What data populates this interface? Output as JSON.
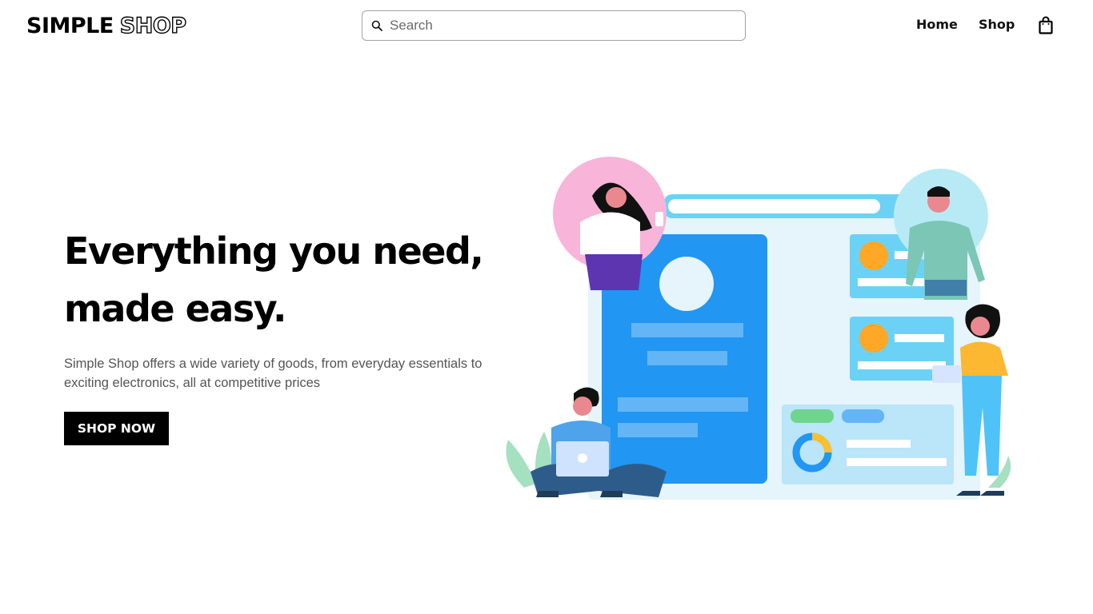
{
  "header": {
    "logo_solid": "SIMPLE",
    "logo_outline": "SHOP",
    "search_placeholder": "Search",
    "search_value": "",
    "nav": {
      "home_label": "Home",
      "shop_label": "Shop"
    },
    "icons": {
      "search": "search-icon",
      "cart": "shopping-bag-icon"
    }
  },
  "hero": {
    "title_line1": "Everything you need,",
    "title_line2": "made easy.",
    "description": "Simple Shop offers a wide variety of goods, from everyday essentials to exciting electronics, all at competitive prices",
    "cta_label": "SHOP NOW"
  },
  "colors": {
    "accent": "#000000",
    "illustration_blue": "#2196F3",
    "illustration_light": "#E6F4FB",
    "illustration_orange": "#FFA726",
    "illustration_pink": "#F8B4D9"
  }
}
